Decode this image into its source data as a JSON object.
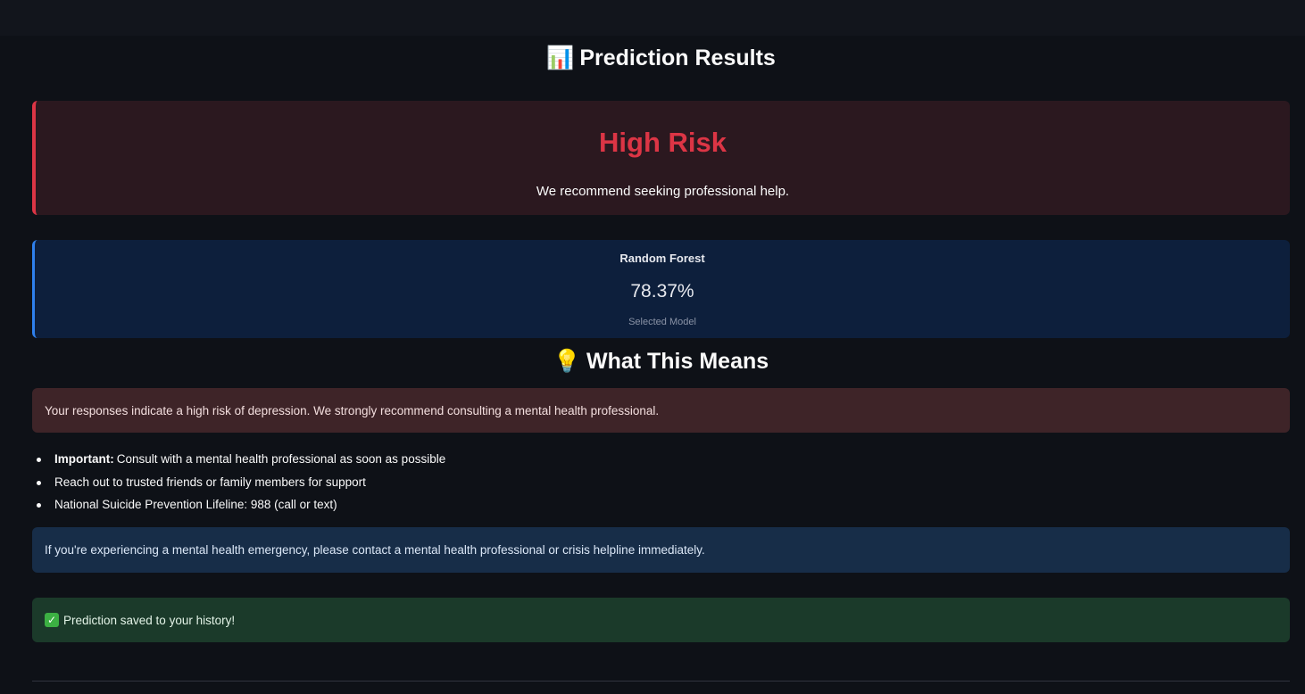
{
  "results": {
    "title_emoji": "📊",
    "title": "Prediction Results"
  },
  "risk": {
    "level": "High Risk",
    "message": "We recommend seeking professional help.",
    "accent_color": "#dc3545"
  },
  "model": {
    "name": "Random Forest",
    "score": "78.37%",
    "caption": "Selected Model",
    "accent_color": "#2f80ed"
  },
  "means": {
    "title_emoji": "💡",
    "title": "What This Means",
    "error_message": "Your responses indicate a high risk of depression. We strongly recommend consulting a mental health professional.",
    "recommendations": [
      {
        "strong": "Important:",
        "text": "Consult with a mental health professional as soon as possible"
      },
      {
        "strong": "",
        "text": "Reach out to trusted friends or family members for support"
      },
      {
        "strong": "",
        "text": "National Suicide Prevention Lifeline: 988 (call or text)"
      }
    ],
    "info_message": "If you're experiencing a mental health emergency, please contact a mental health professional or crisis helpline immediately."
  },
  "success": {
    "icon": "check-icon",
    "message": "Prediction saved to your history!"
  }
}
